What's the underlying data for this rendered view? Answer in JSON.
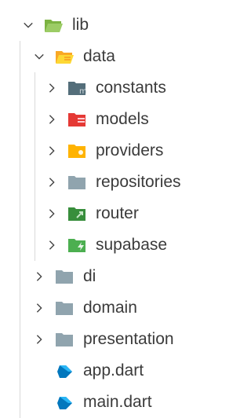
{
  "explorer": {
    "items": [
      {
        "label": "lib",
        "icon": "folder-lib-open-icon",
        "color": "#8BC34A",
        "expanded": true
      },
      {
        "label": "data",
        "icon": "folder-data-open-icon",
        "color": "#FBC02D",
        "expanded": true
      },
      {
        "label": "constants",
        "icon": "folder-constants-icon",
        "color": "#546E7A",
        "expanded": false
      },
      {
        "label": "models",
        "icon": "folder-models-icon",
        "color": "#EF5350",
        "expanded": false
      },
      {
        "label": "providers",
        "icon": "folder-providers-icon",
        "color": "#FFB300",
        "expanded": false
      },
      {
        "label": "repositories",
        "icon": "folder-icon",
        "color": "#90A4AE",
        "expanded": false
      },
      {
        "label": "router",
        "icon": "folder-router-icon",
        "color": "#43A047",
        "expanded": false
      },
      {
        "label": "supabase",
        "icon": "folder-supabase-icon",
        "color": "#4CAF50",
        "expanded": false
      },
      {
        "label": "di",
        "icon": "folder-icon",
        "color": "#90A4AE",
        "expanded": false
      },
      {
        "label": "domain",
        "icon": "folder-icon",
        "color": "#90A4AE",
        "expanded": false
      },
      {
        "label": "presentation",
        "icon": "folder-icon",
        "color": "#90A4AE",
        "expanded": false
      },
      {
        "label": "app.dart",
        "icon": "dart-file-icon",
        "color": "#0277BD"
      },
      {
        "label": "main.dart",
        "icon": "dart-file-icon",
        "color": "#0277BD"
      }
    ]
  }
}
